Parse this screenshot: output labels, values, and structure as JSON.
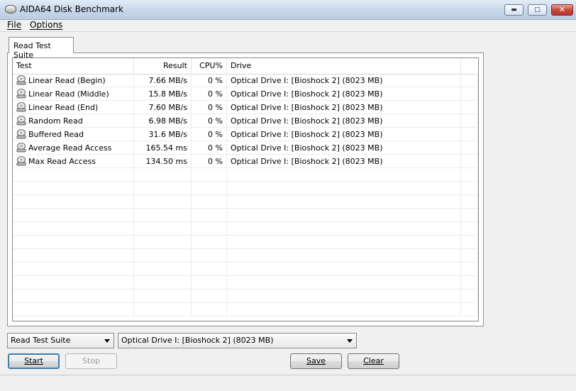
{
  "window": {
    "title": "AIDA64 Disk Benchmark",
    "minimize_icon": "minimize-icon",
    "maximize_icon": "maximize-icon",
    "close_icon": "close-icon"
  },
  "menu": {
    "file": "File",
    "options": "Options"
  },
  "tab": {
    "label": "Read Test Suite"
  },
  "table": {
    "columns": {
      "test": "Test",
      "result": "Result",
      "cpu": "CPU%",
      "drive": "Drive"
    },
    "rows": [
      {
        "test": "Linear Read (Begin)",
        "result": "7.66 MB/s",
        "cpu": "0 %",
        "drive": "Optical Drive I:  [Bioshock 2]  (8023 MB)"
      },
      {
        "test": "Linear Read (Middle)",
        "result": "15.8 MB/s",
        "cpu": "0 %",
        "drive": "Optical Drive I:  [Bioshock 2]  (8023 MB)"
      },
      {
        "test": "Linear Read (End)",
        "result": "7.60 MB/s",
        "cpu": "0 %",
        "drive": "Optical Drive I:  [Bioshock 2]  (8023 MB)"
      },
      {
        "test": "Random Read",
        "result": "6.98 MB/s",
        "cpu": "0 %",
        "drive": "Optical Drive I:  [Bioshock 2]  (8023 MB)"
      },
      {
        "test": "Buffered Read",
        "result": "31.6 MB/s",
        "cpu": "0 %",
        "drive": "Optical Drive I:  [Bioshock 2]  (8023 MB)"
      },
      {
        "test": "Average Read Access",
        "result": "165.54 ms",
        "cpu": "0 %",
        "drive": "Optical Drive I:  [Bioshock 2]  (8023 MB)"
      },
      {
        "test": "Max Read Access",
        "result": "134.50 ms",
        "cpu": "0 %",
        "drive": "Optical Drive I:  [Bioshock 2]  (8023 MB)"
      }
    ],
    "row_icon": "disk-drive-icon"
  },
  "controls": {
    "suite_select": "Read Test Suite",
    "drive_select": "Optical Drive I:  [Bioshock 2]  (8023 MB)",
    "start": "Start",
    "stop": "Stop",
    "save": "Save",
    "clear": "Clear"
  }
}
